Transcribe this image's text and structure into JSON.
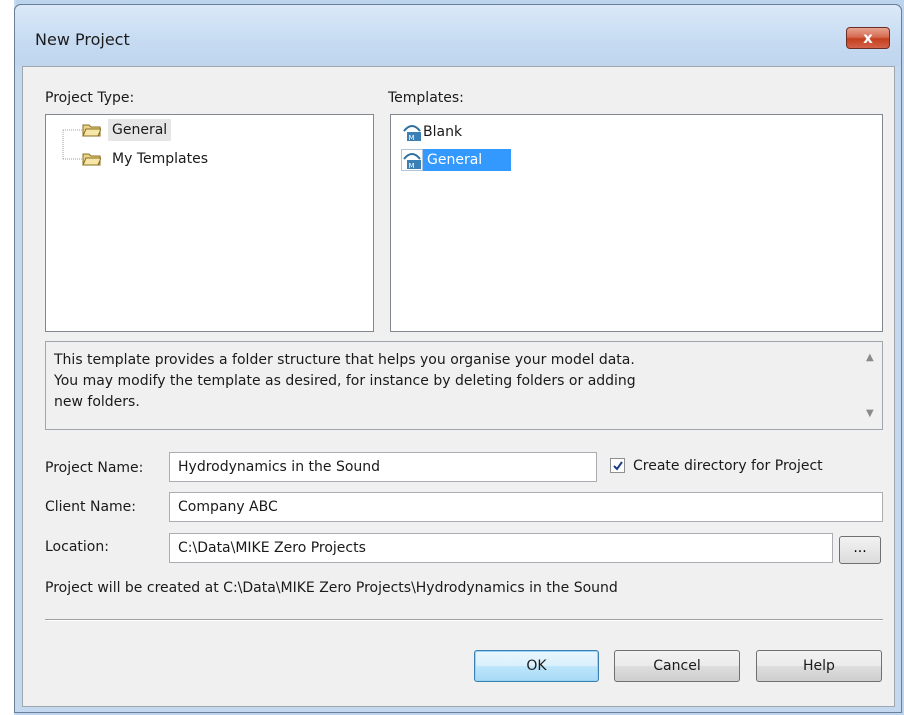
{
  "window": {
    "title": "New Project",
    "close_label": "x"
  },
  "project_type": {
    "label": "Project Type:",
    "items": [
      {
        "label": "General",
        "icon": "folder-icon",
        "selected": true
      },
      {
        "label": "My Templates",
        "icon": "folder-icon",
        "selected": false
      }
    ]
  },
  "templates": {
    "label": "Templates:",
    "items": [
      {
        "label": "Blank",
        "icon": "mike-zero-template-icon",
        "selected": false
      },
      {
        "label": "General",
        "icon": "mike-zero-template-icon",
        "selected": true
      }
    ]
  },
  "description": {
    "text": "This template provides a folder structure that helps you organise your model data. You may modify the template as desired, for instance by deleting folders or adding new folders."
  },
  "form": {
    "project_name_label": "Project Name:",
    "project_name_value": "Hydrodynamics in the Sound",
    "create_directory_label": "Create directory for Project",
    "create_directory_checked": true,
    "client_name_label": "Client Name:",
    "client_name_value": "Company ABC",
    "location_label": "Location:",
    "location_value": "C:\\Data\\MIKE Zero Projects",
    "browse_label": "...",
    "summary": "Project will be created at C:\\Data\\MIKE Zero Projects\\Hydrodynamics in the Sound"
  },
  "buttons": {
    "ok": "OK",
    "cancel": "Cancel",
    "help": "Help"
  },
  "colors": {
    "selection": "#3399ff",
    "close_button": "#c3401f",
    "dialog_bg": "#f0f0f0"
  }
}
